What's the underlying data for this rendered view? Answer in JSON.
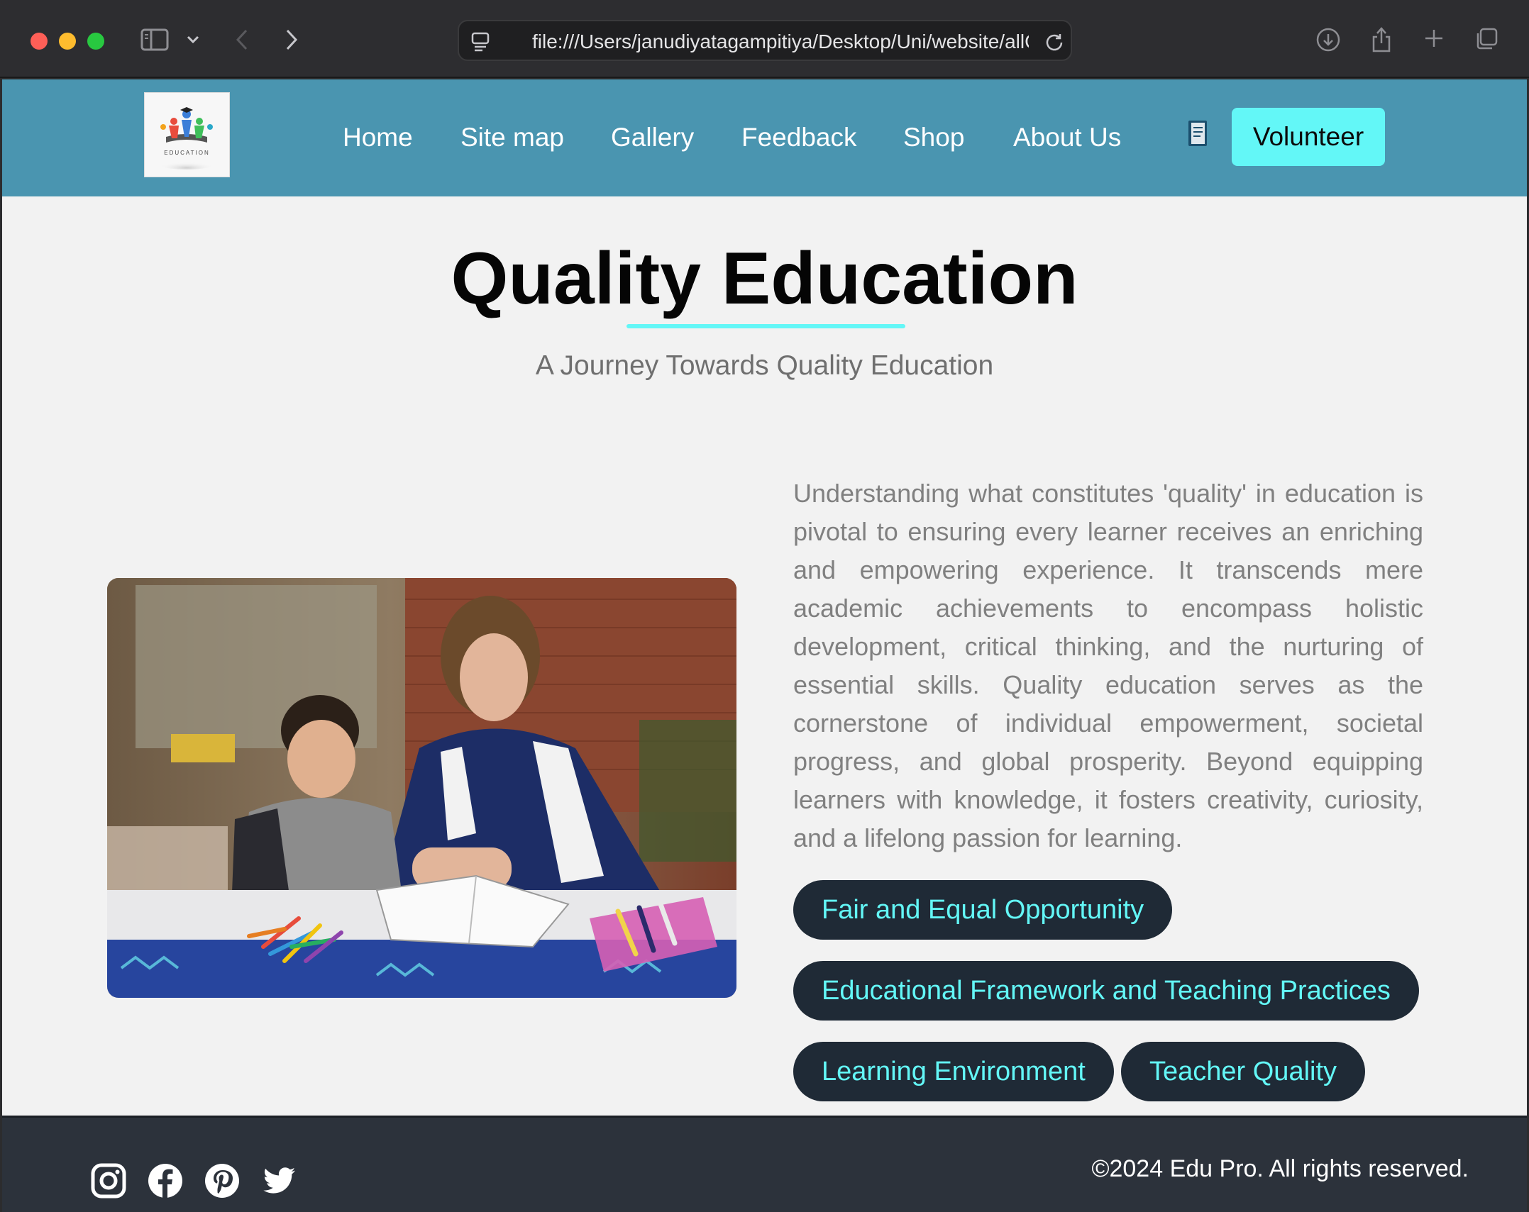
{
  "browser": {
    "url": "file:///Users/janudiyatagampitiya/Desktop/Uni/website/allC"
  },
  "header": {
    "nav": [
      "Home",
      "Site map",
      "Gallery",
      "Feedback",
      "Shop",
      "About Us"
    ],
    "volunteer_label": "Volunteer",
    "logo_text": "EDUCATION"
  },
  "hero": {
    "title": "Quality Education",
    "subtitle": "A Journey Towards Quality Education"
  },
  "content": {
    "paragraph": "Understanding what constitutes 'quality' in education is pivotal to ensuring every learner receives an enriching and empowering experience. It transcends mere academic achievements to encompass holistic development, critical thinking, and the nurturing of essential skills. Quality education serves as the cornerstone of individual empowerment, societal progress, and global prosperity. Beyond equipping learners with knowledge, it fosters creativity, curiosity, and a lifelong passion for learning.",
    "topics": [
      "Fair and Equal Opportunity",
      "Educational Framework and Teaching Practices",
      "Learning Environment",
      "Teacher Quality"
    ]
  },
  "footer": {
    "social": [
      "instagram-icon",
      "facebook-icon",
      "pinterest-icon",
      "twitter-icon"
    ],
    "copyright": "©2024 Edu Pro. All rights reserved."
  },
  "colors": {
    "header_bg": "#4a95b0",
    "accent_cyan": "#63f7f7",
    "pill_bg": "#1f2a36",
    "footer_bg": "#2c323b",
    "page_bg": "#f2f2f2"
  }
}
